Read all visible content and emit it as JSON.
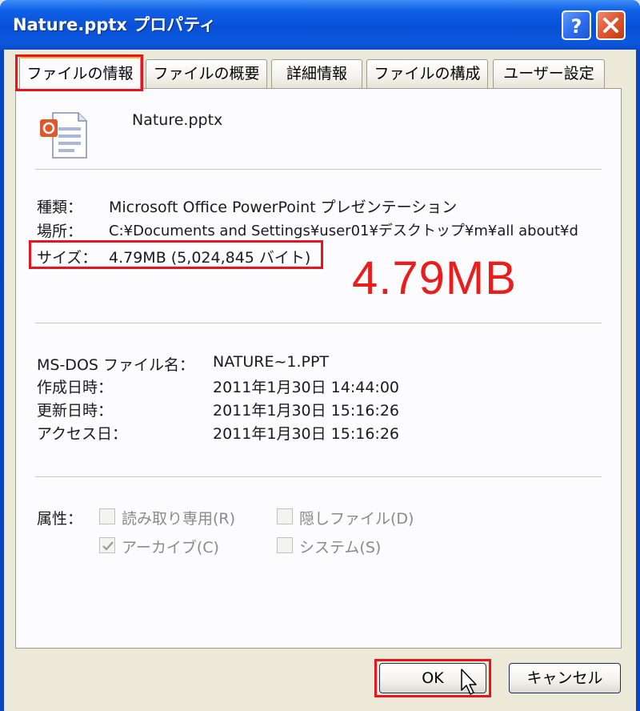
{
  "window": {
    "title": "Nature.pptx プロパティ",
    "help_icon": "question-mark",
    "close_icon": "x-close"
  },
  "tabs": [
    {
      "label": "ファイルの情報",
      "active": true
    },
    {
      "label": "ファイルの概要",
      "active": false
    },
    {
      "label": "詳細情報",
      "active": false
    },
    {
      "label": "ファイルの構成",
      "active": false
    },
    {
      "label": "ユーザー設定",
      "active": false
    }
  ],
  "file": {
    "icon": "powerpoint-file-icon",
    "name": "Nature.pptx"
  },
  "general": {
    "type_label": "種類：",
    "type_value": "Microsoft Office PowerPoint プレゼンテーション",
    "location_label": "場所：",
    "location_value": "C:¥Documents and Settings¥user01¥デスクトップ¥m¥all about¥d",
    "size_label": "サイズ：",
    "size_value": "4.79MB (5,024,845 バイト)"
  },
  "annotation": "4.79MB",
  "details": {
    "msdos_label": "MS-DOS ファイル名：",
    "msdos_value": "NATURE~1.PPT",
    "created_label": "作成日時：",
    "created_value": "2011年1月30日 14:44:00",
    "modified_label": "更新日時：",
    "modified_value": "2011年1月30日 15:16:26",
    "accessed_label": "アクセス日：",
    "accessed_value": "2011年1月30日 15:16:26"
  },
  "attributes": {
    "label": "属性：",
    "readonly": {
      "label": "読み取り専用(R)",
      "checked": false
    },
    "hidden": {
      "label": "隠しファイル(D)",
      "checked": false
    },
    "archive": {
      "label": "アーカイブ(C)",
      "checked": true
    },
    "system": {
      "label": "システム(S)",
      "checked": false
    }
  },
  "buttons": {
    "ok": "OK",
    "cancel": "キャンセル"
  },
  "colors": {
    "highlight": "#e8141e",
    "titlebar": "#0850d6"
  }
}
